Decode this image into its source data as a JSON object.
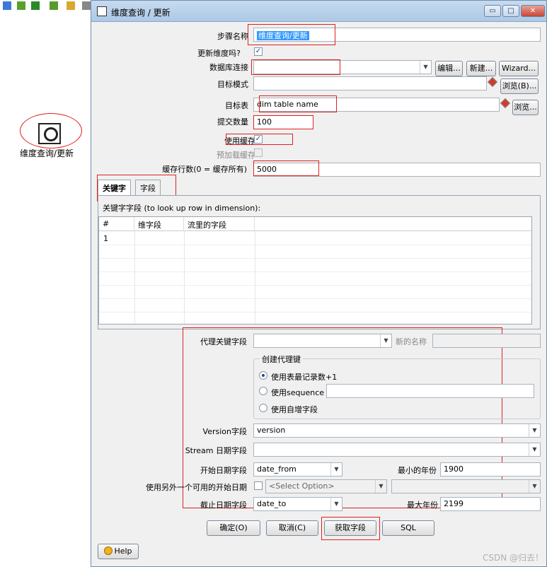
{
  "canvas": {
    "step_label": "维度查询/更新"
  },
  "window": {
    "title": "维度查询 / 更新",
    "controls": {
      "minimize": "▭",
      "maximize": "□",
      "close": "✕"
    }
  },
  "form": {
    "step_name_label": "步骤名称",
    "step_name_value": "维度查询/更新",
    "update_dim_label": "更新维度吗?",
    "update_dim_checked": "✓",
    "db_conn_label": "数据库连接",
    "db_conn_value": "",
    "edit_btn": "编辑...",
    "new_btn": "新建...",
    "wizard_btn": "Wizard...",
    "target_schema_label": "目标模式",
    "target_schema_value": "",
    "browse_b_btn": "浏览(B)...",
    "target_table_label": "目标表",
    "target_table_value": "dim table name",
    "browse_btn": "浏览...",
    "commit_label": "提交数量",
    "commit_value": "100",
    "use_cache_label": "使用缓存",
    "use_cache_checked": "✓",
    "preload_label": "预加载缓存",
    "cache_rows_label": "缓存行数(0 = 缓存所有)",
    "cache_rows_value": "5000"
  },
  "tabs": {
    "keys": "关键字",
    "fields": "字段"
  },
  "keys_panel": {
    "caption": "关键字字段 (to look up row in dimension):",
    "columns": [
      "#",
      "维字段",
      "流里的字段"
    ],
    "rows": [
      {
        "num": "1",
        "dim": "",
        "stream": ""
      }
    ]
  },
  "surrogate": {
    "key_label": "代理关键字段",
    "key_value": "",
    "new_name_label": "新的名称",
    "new_name_value": "",
    "group_title": "创建代理键",
    "opt_table_max": "使用表最记录数+1",
    "opt_sequence": "使用sequence",
    "opt_autoinc": "使用自增字段",
    "version_label": "Version字段",
    "version_value": "version",
    "stream_date_label": "Stream 日期字段",
    "stream_date_value": "",
    "start_date_label": "开始日期字段",
    "start_date_value": "date_from",
    "min_year_label": "最小的年份",
    "min_year_value": "1900",
    "alt_start_label": "使用另外一个可用的开始日期",
    "alt_start_placeholder": "<Select Option>",
    "end_date_label": "截止日期字段",
    "end_date_value": "date_to",
    "max_year_label": "最大年份",
    "max_year_value": "2199"
  },
  "buttons": {
    "ok": "确定(O)",
    "cancel": "取消(C)",
    "get_fields": "获取字段",
    "sql": "SQL",
    "help": "Help"
  },
  "watermark": "CSDN @归去！",
  "colors": {
    "annotation_red": "#e02020",
    "title_bar": "#c7dbef"
  }
}
